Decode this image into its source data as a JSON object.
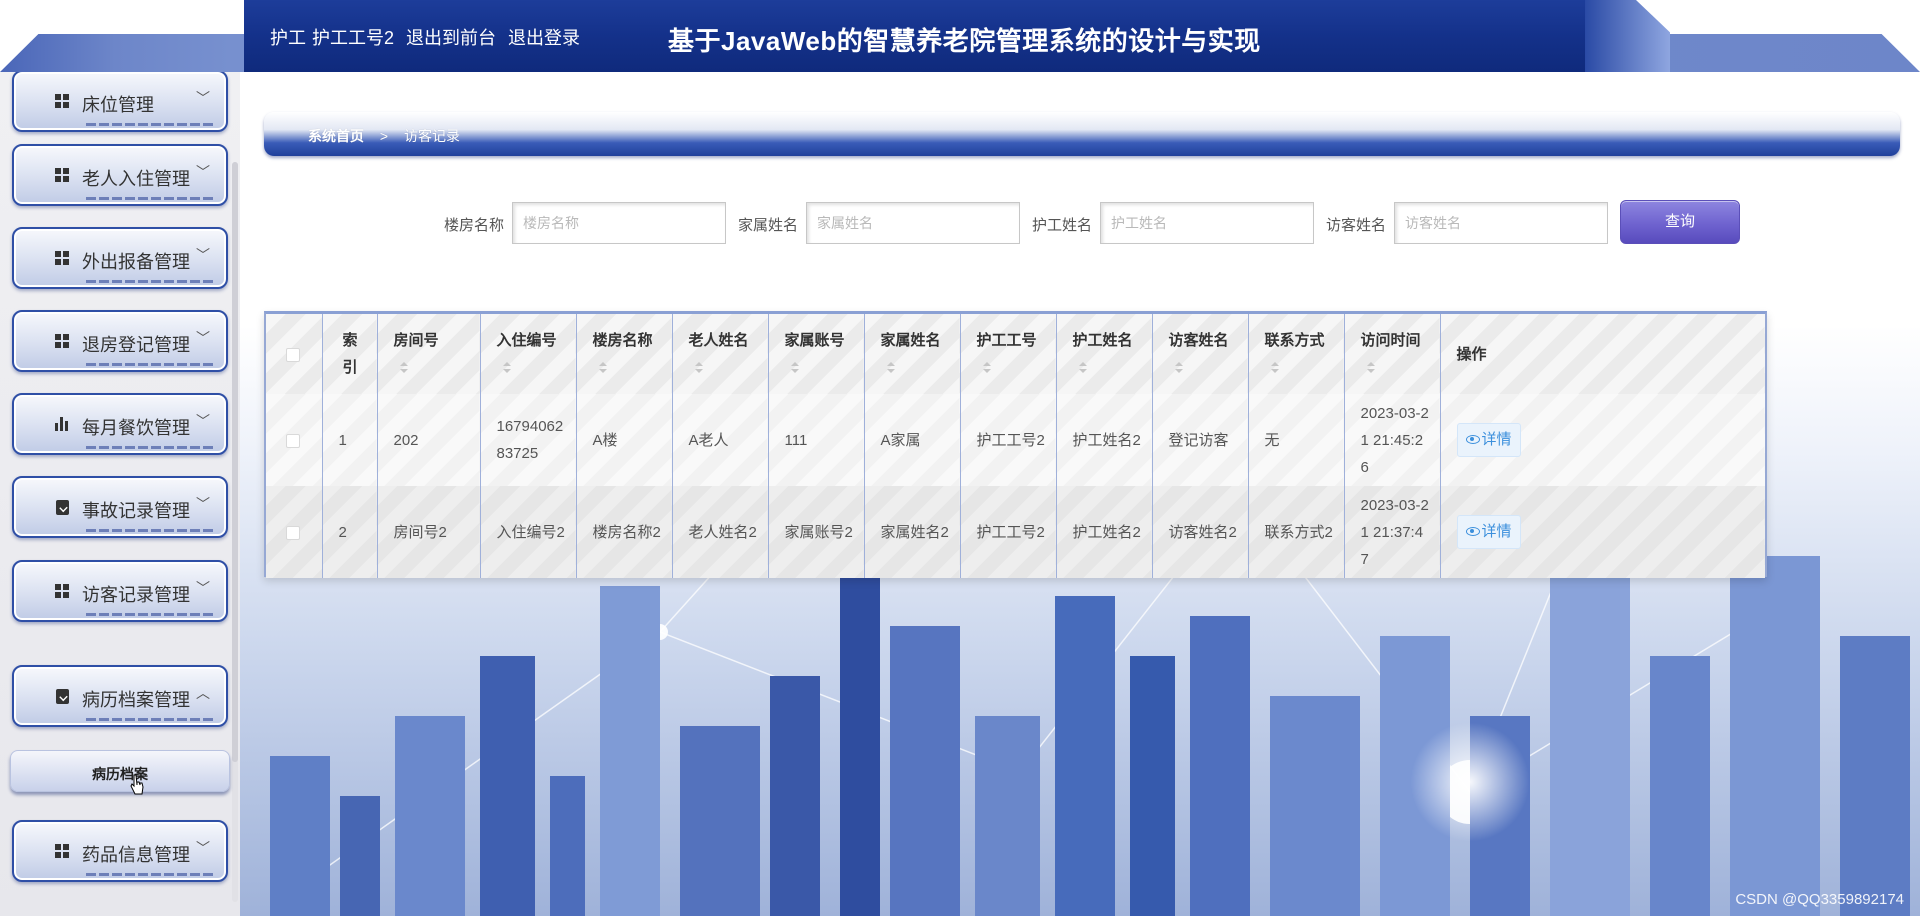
{
  "header": {
    "user_role": "护工",
    "user_name": "护工工号2",
    "back_to_front": "退出到前台",
    "logout": "退出登录",
    "title": "基于JavaWeb的智慧养老院管理系统的设计与实现"
  },
  "sidebar": {
    "items": [
      {
        "label": "床位管理",
        "icon": "grid-icon",
        "arrow": "﹀"
      },
      {
        "label": "老人入住管理",
        "icon": "grid-icon",
        "arrow": "﹀"
      },
      {
        "label": "外出报备管理",
        "icon": "grid-icon",
        "arrow": "﹀"
      },
      {
        "label": "退房登记管理",
        "icon": "grid-icon",
        "arrow": "﹀"
      },
      {
        "label": "每月餐饮管理",
        "icon": "bar-chart-icon",
        "arrow": "﹀"
      },
      {
        "label": "事故记录管理",
        "icon": "clipboard-x-icon",
        "arrow": "﹀"
      },
      {
        "label": "访客记录管理",
        "icon": "grid-icon",
        "arrow": "﹀"
      },
      {
        "label": "病历档案管理",
        "icon": "clipboard-check-icon",
        "arrow": "︿"
      },
      {
        "label": "药品信息管理",
        "icon": "grid-icon",
        "arrow": "﹀"
      }
    ],
    "submenu": {
      "label": "病历档案"
    }
  },
  "breadcrumb": {
    "home": "系统首页",
    "separator": ">",
    "current": "访客记录"
  },
  "search": {
    "fields": [
      {
        "label": "楼房名称",
        "placeholder": "楼房名称"
      },
      {
        "label": "家属姓名",
        "placeholder": "家属姓名"
      },
      {
        "label": "护工姓名",
        "placeholder": "护工姓名"
      },
      {
        "label": "访客姓名",
        "placeholder": "访客姓名"
      }
    ],
    "button": "查询"
  },
  "table": {
    "headers": [
      "索引",
      "房间号",
      "入住编号",
      "楼房名称",
      "老人姓名",
      "家属账号",
      "家属姓名",
      "护工工号",
      "护工姓名",
      "访客姓名",
      "联系方式",
      "访问时间",
      "操作"
    ],
    "rows": [
      [
        "1",
        "202",
        "1679406283725",
        "A楼",
        "A老人",
        "111",
        "A家属",
        "护工工号2",
        "护工姓名2",
        "登记访客",
        "无",
        "2023-03-21 21:45:26"
      ],
      [
        "2",
        "房间号2",
        "入住编号2",
        "楼房名称2",
        "老人姓名2",
        "家属账号2",
        "家属姓名2",
        "护工工号2",
        "护工姓名2",
        "访客姓名2",
        "联系方式2",
        "2023-03-21 21:37:47"
      ]
    ],
    "detail_label": "详情"
  },
  "watermark": "CSDN @QQ3359892174",
  "colors": {
    "header_bg": "#14318a",
    "accent_button": "#6f63cf",
    "detail_link": "#3b8fdc",
    "menu_border": "#2f4fa6"
  }
}
